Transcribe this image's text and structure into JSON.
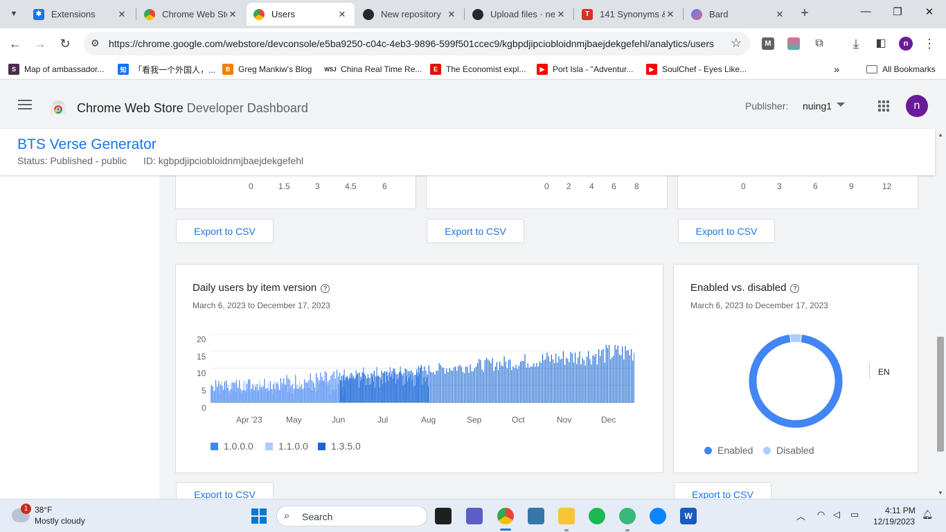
{
  "browser": {
    "tabs": [
      {
        "title": "Extensions",
        "active": false
      },
      {
        "title": "Chrome Web Sto",
        "active": false
      },
      {
        "title": "Users",
        "active": true
      },
      {
        "title": "New repository",
        "active": false
      },
      {
        "title": "Upload files · ne",
        "active": false
      },
      {
        "title": "141 Synonyms &",
        "active": false
      },
      {
        "title": "Bard",
        "active": false
      }
    ],
    "new_tab": "+",
    "close_glyph": "✕",
    "url": "https://chrome.google.com/webstore/devconsole/e5ba9250-c04c-4eb3-9896-599f501ccec9/kgbpdjipciobloidnmjbaejdekgefehl/analytics/users",
    "profile_initial": "n",
    "bookmarks": [
      {
        "label": "Map of ambassador..."
      },
      {
        "label": "「看我一个外国人，..."
      },
      {
        "label": "Greg Mankiw's Blog"
      },
      {
        "label": "China Real Time Re..."
      },
      {
        "label": "The Economist expl..."
      },
      {
        "label": "Port Isla - \"Adventur..."
      },
      {
        "label": "SoulChef - Eyes Like..."
      }
    ],
    "bookmarks_overflow": "»",
    "all_bookmarks": "All Bookmarks"
  },
  "dashboard": {
    "title_main": "Chrome Web Store",
    "title_sub": "Developer Dashboard",
    "publisher_label": "Publisher:",
    "publisher_value": "nuing1",
    "avatar_initial": "n"
  },
  "item": {
    "name": "BTS Verse Generator",
    "status": "Status: Published - public",
    "id": "ID: kgbpdjipciobloidnmjbaejdekgefehl"
  },
  "top_charts": {
    "axis1": [
      "0",
      "1.5",
      "3",
      "4.5",
      "6"
    ],
    "axis2": [
      "0",
      "2",
      "4",
      "6",
      "8"
    ],
    "axis3": [
      "0",
      "3",
      "6",
      "9",
      "12"
    ],
    "export_label": "Export to CSV"
  },
  "daily_chart": {
    "title": "Daily users by item version",
    "date_range": "March 6, 2023 to December 17, 2023",
    "yticks": [
      "0",
      "5",
      "10",
      "15",
      "20"
    ],
    "months": [
      "Apr '23",
      "May",
      "Jun",
      "Jul",
      "Aug",
      "Sep",
      "Oct",
      "Nov",
      "Dec"
    ],
    "legend": [
      {
        "label": "1.0.0.0",
        "color": "#4285f4"
      },
      {
        "label": "1.1.0.0",
        "color": "#aecbfa"
      },
      {
        "label": "1.3.5.0",
        "color": "#1967d2"
      }
    ],
    "export_label": "Export to CSV"
  },
  "enabled_chart": {
    "title": "Enabled vs. disabled",
    "date_range": "March 6, 2023 to December 17, 2023",
    "legend": [
      {
        "label": "Enabled",
        "color": "#4285f4"
      },
      {
        "label": "Disabled",
        "color": "#aecbfa"
      }
    ],
    "lang": "EN",
    "export_label": "Export to CSV"
  },
  "chart_data": [
    {
      "type": "bar",
      "title": "Daily users by item version",
      "x_range": [
        "2023-03-06",
        "2023-12-17"
      ],
      "ylim": [
        0,
        20
      ],
      "series": [
        {
          "name": "1.1.0.0",
          "period": [
            "2023-03-06",
            "2023-06-05"
          ],
          "typical_range": [
            1,
            8
          ]
        },
        {
          "name": "1.0.0.0",
          "period": [
            "2023-03-06",
            "2023-07-31"
          ],
          "typical_range": [
            2,
            11
          ]
        },
        {
          "name": "1.3.5.0",
          "period": [
            "2023-06-01",
            "2023-12-17"
          ],
          "typical_range": [
            4,
            18
          ]
        }
      ],
      "legend_position": "bottom-left"
    },
    {
      "type": "pie",
      "title": "Enabled vs. disabled",
      "categories": [
        "Enabled",
        "Disabled"
      ],
      "values": [
        96,
        4
      ],
      "donut": true,
      "legend_position": "bottom"
    }
  ],
  "taskbar": {
    "weather_temp": "38°F",
    "weather_desc": "Mostly cloudy",
    "weather_badge": "1",
    "search_label": "Search",
    "time": "4:11 PM",
    "date": "12/19/2023"
  }
}
